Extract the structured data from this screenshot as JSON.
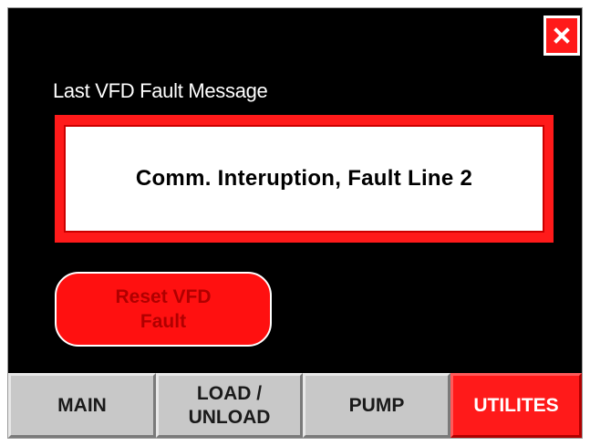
{
  "fault_panel": {
    "label": "Last VFD Fault Message",
    "message": "Comm. Interuption, Fault Line 2"
  },
  "reset_button": {
    "label": "Reset VFD\nFault"
  },
  "close_button": {
    "icon": "close-icon"
  },
  "tabs": [
    {
      "label": "MAIN",
      "active": false
    },
    {
      "label": "LOAD /\nUNLOAD",
      "active": false
    },
    {
      "label": "PUMP",
      "active": false
    },
    {
      "label": "UTILITES",
      "active": true
    }
  ],
  "colors": {
    "background": "#000000",
    "accent": "#ff1a1a",
    "tab_inactive": "#c8c8c8",
    "message_bg": "#ffffff"
  }
}
